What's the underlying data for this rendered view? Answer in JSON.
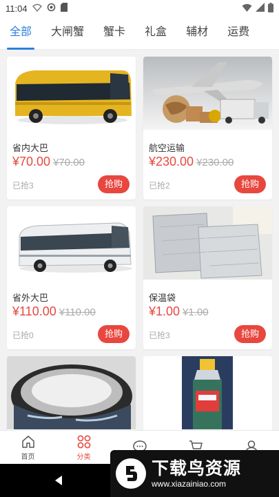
{
  "status_bar": {
    "time": "11:04"
  },
  "tabs": [
    {
      "label": "全部",
      "active": true
    },
    {
      "label": "大闸蟹",
      "active": false
    },
    {
      "label": "蟹卡",
      "active": false
    },
    {
      "label": "礼盒",
      "active": false
    },
    {
      "label": "辅材",
      "active": false
    },
    {
      "label": "运费",
      "active": false
    }
  ],
  "products": [
    {
      "name": "省内大巴",
      "price": "¥70.00",
      "original_price": "¥70.00",
      "sold": "已抢3",
      "buy_label": "抢购",
      "image_icon": "yellow-bus-image"
    },
    {
      "name": "航空运输",
      "price": "¥230.00",
      "original_price": "¥230.00",
      "sold": "已抢2",
      "buy_label": "抢购",
      "image_icon": "airplane-cargo-image"
    },
    {
      "name": "省外大巴",
      "price": "¥110.00",
      "original_price": "¥110.00",
      "sold": "已抢0",
      "buy_label": "抢购",
      "image_icon": "white-bus-image"
    },
    {
      "name": "保温袋",
      "price": "¥1.00",
      "original_price": "¥1.00",
      "sold": "已抢3",
      "buy_label": "抢购",
      "image_icon": "insulated-bag-image"
    },
    {
      "name": "",
      "image_icon": "tape-roll-image"
    },
    {
      "name": "",
      "image_icon": "bottle-image"
    }
  ],
  "bottom_nav": [
    {
      "label": "首页",
      "icon": "home-icon",
      "active": false
    },
    {
      "label": "分类",
      "icon": "category-icon",
      "active": true
    },
    {
      "label": "",
      "icon": "chat-icon",
      "active": false
    },
    {
      "label": "",
      "icon": "cart-icon",
      "active": false
    },
    {
      "label": "",
      "icon": "user-icon",
      "active": false
    }
  ],
  "watermark": {
    "title": "下载鸟资源",
    "url": "www.xiazainiao.com"
  },
  "colors": {
    "accent_blue": "#2b7fde",
    "price_red": "#e8473f",
    "background": "#f2f2f2"
  }
}
